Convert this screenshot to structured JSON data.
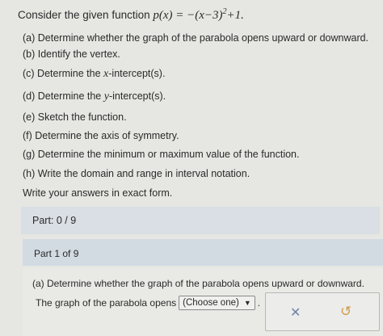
{
  "problem": {
    "intro_prefix": "Consider the given function",
    "formula_lhs": "p(x) = −(x−3)",
    "formula_exp": "2",
    "formula_rhs": "+1.",
    "items": [
      "(a) Determine whether the graph of the parabola opens upward or downward.",
      "(b) Identify the vertex.",
      "(c) Determine the",
      "(d) Determine the",
      "(e) Sketch the function.",
      "(f) Determine the axis of symmetry.",
      "(g) Determine the minimum or maximum value of the function.",
      "(h) Write the domain and range in interval notation."
    ],
    "c_var": "x",
    "c_suffix": "-intercept(s).",
    "d_var": "y",
    "d_suffix": "-intercept(s).",
    "exact_note": "Write your answers in exact form."
  },
  "progress": {
    "label": "Part: 0 / 9",
    "part_of": "Part 1 of 9"
  },
  "part1": {
    "question": "(a) Determine whether the graph of the parabola opens upward or downward.",
    "answer_prefix": "The graph of the parabola opens",
    "select_value": "(Choose one)",
    "period": "."
  },
  "icons": {
    "dropdown": "chevron-down-icon",
    "clear": "close-icon",
    "undo": "undo-icon"
  },
  "colors": {
    "part_count_bg": "#d9dfe4",
    "part_header_bg": "#d2dae2",
    "clear_icon": "#6f84a8",
    "undo_icon": "#d29a4a"
  }
}
